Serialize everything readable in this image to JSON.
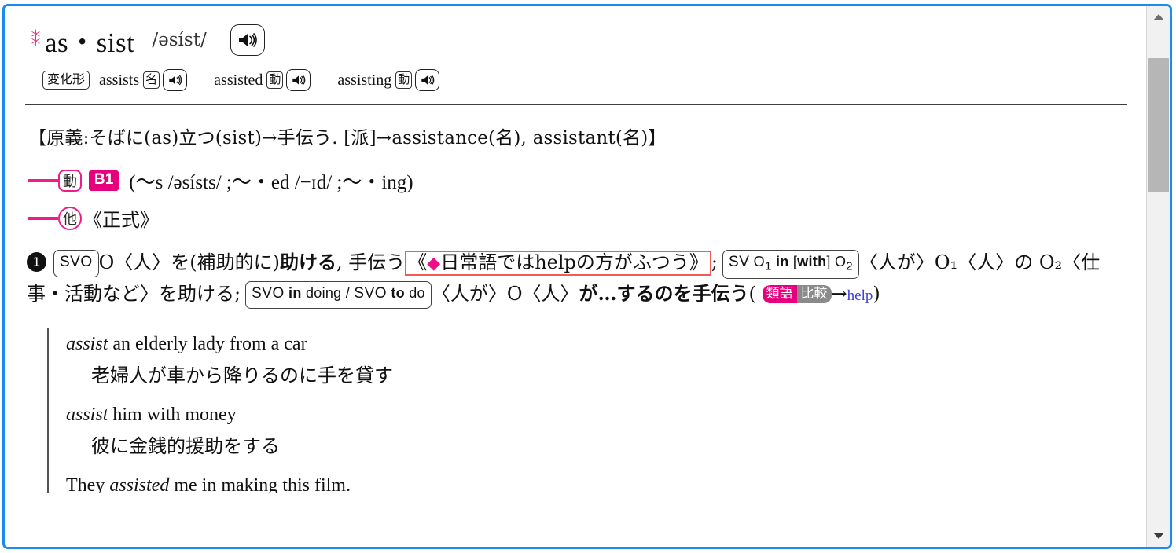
{
  "window": {
    "frame_color": "#1a8cf0",
    "background": "#ffffff"
  },
  "entry": {
    "star_mark": "＊",
    "headword": "as・sist",
    "phonetic": "/əsíst/",
    "audio_icon": "speaker-icon",
    "inflection_label": "変化形",
    "inflections": [
      {
        "word": "assists",
        "pos": "名",
        "audio_icon": "speaker-icon"
      },
      {
        "word": "assisted",
        "pos": "動",
        "audio_icon": "speaker-icon"
      },
      {
        "word": "assisting",
        "pos": "動",
        "audio_icon": "speaker-icon"
      }
    ],
    "etymology": "【原義:そばに(as)立つ(sist)→手伝う. [派]→assistance(名), assistant(名)】",
    "verb_block": {
      "pos": "動",
      "level_badge": "B1",
      "level_badge_color": "#e6007e",
      "inflection_phonetics": "(〜s /əsísts/ ;〜・ed /−ɪd/ ;〜・ing)",
      "transitivity": "他",
      "register": "《正式》"
    },
    "senses": [
      {
        "number": "❶",
        "pattern1": "SVO",
        "definition_a": "O〈人〉を(補助的に)",
        "definition_a_bold": "助ける",
        "definition_a_tail": ", 手伝う",
        "note_highlight": "《◆日常語ではhelpの方がふつう》",
        "note_diamond": "◆",
        "note_border_color": "#f05b57",
        "separator": ";",
        "pattern2": "SVO₁ in [with] O₂",
        "pattern2_parts": {
          "head": "SV O",
          "sub1": "1",
          "mid": "in [with] O",
          "sub2": "2"
        },
        "definition_b": "〈人が〉O₁〈人〉の O₂〈仕事・活動など〉を助ける;",
        "pattern3": "SVO in doing / SVO to do",
        "definition_c_pre": "〈人が〉O〈人〉",
        "definition_c_bold": "が…するのを手伝う",
        "thesaurus_badge": "類語",
        "compare_badge": "比較",
        "cross_ref_arrow": "→",
        "cross_ref": "help",
        "cross_ref_color": "#3a40d8"
      }
    ],
    "examples": [
      {
        "en_italic": "assist",
        "en_rest": " an elderly lady from a car",
        "jp": "老婦人が車から降りるのに手を貸す"
      },
      {
        "en_italic": "assist",
        "en_rest": " him with money",
        "jp": "彼に金銭的援助をする"
      },
      {
        "en_pre": "They ",
        "en_italic2": "assisted",
        "en_rest2": " me in making this film.",
        "jp": ""
      }
    ]
  },
  "scrollbar": {
    "up_arrow": "scroll-up-icon",
    "down_arrow": "scroll-down-icon",
    "thumb_position_percent": 6,
    "thumb_size_percent": 27
  }
}
